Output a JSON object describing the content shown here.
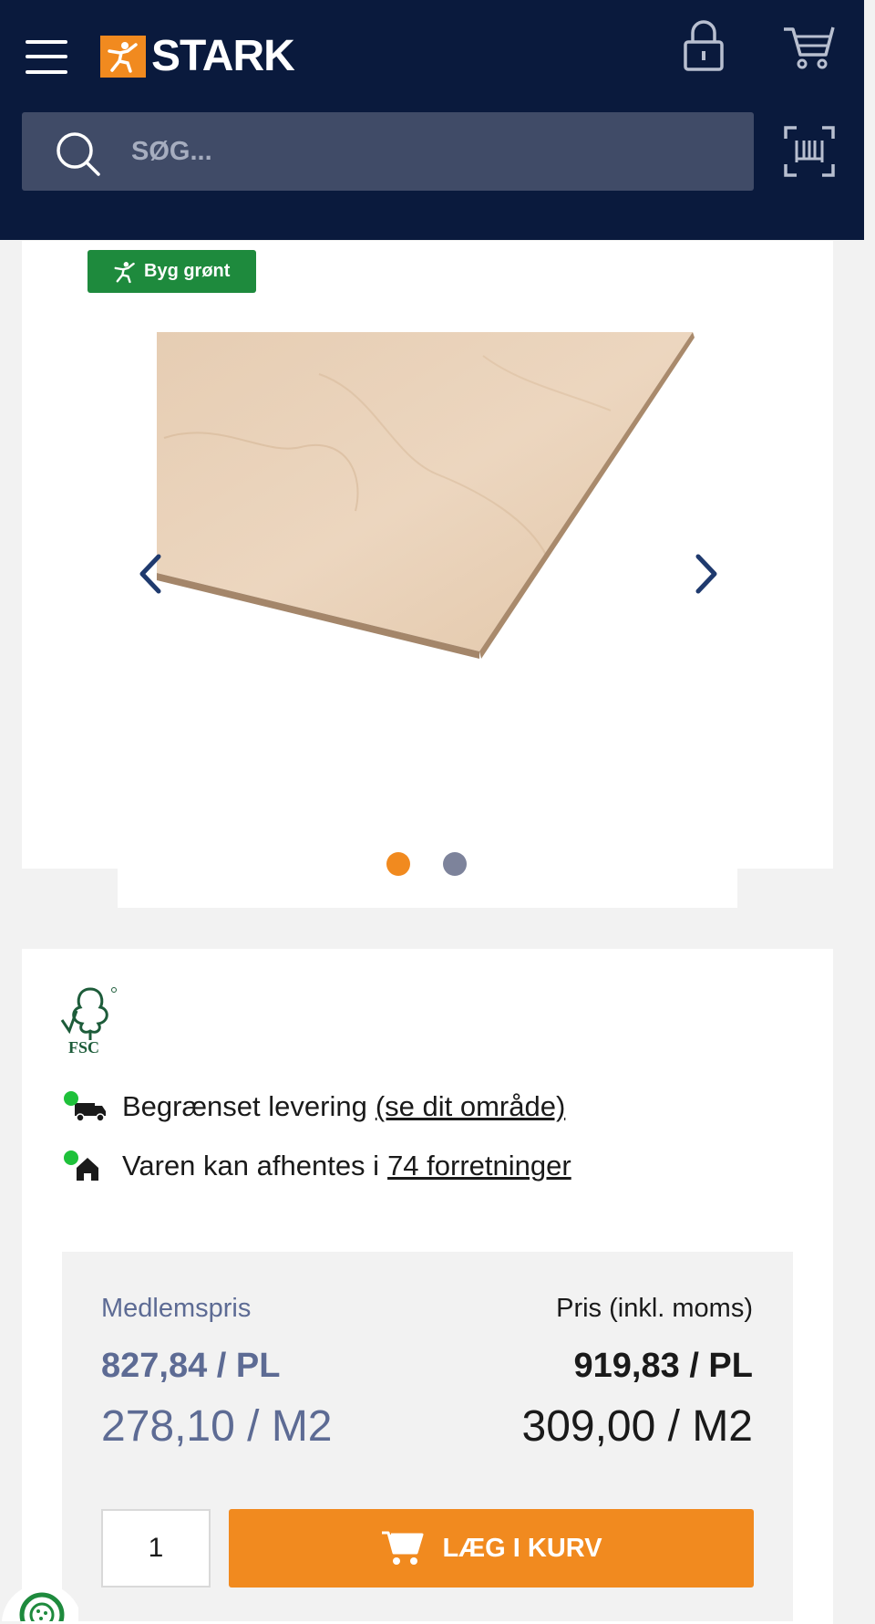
{
  "header": {
    "brand": "STARK",
    "search_placeholder": "SØG..."
  },
  "gallery": {
    "badge_label": "Byg grønt",
    "dot_active_color": "#f18a1f",
    "dot_inactive_color": "#7d839b"
  },
  "availability": {
    "delivery_text": "Begrænset levering",
    "delivery_link": "(se dit område)",
    "pickup_text": "Varen kan afhentes i",
    "pickup_link": "74 forretninger"
  },
  "pricing": {
    "member_label": "Medlemspris",
    "member_price_pl": "827,84 / PL",
    "member_price_m2": "278,10 / M2",
    "price_label": "Pris (inkl. moms)",
    "price_pl": "919,83 / PL",
    "price_m2": "309,00 / M2"
  },
  "cart": {
    "quantity": "1",
    "add_label": "LÆG I KURV"
  },
  "fsc_label": "FSC",
  "colors": {
    "header_bg": "#0a1a3d",
    "accent": "#f18a1f",
    "green": "#1e8a3d",
    "member_blue": "#5d6b94"
  }
}
